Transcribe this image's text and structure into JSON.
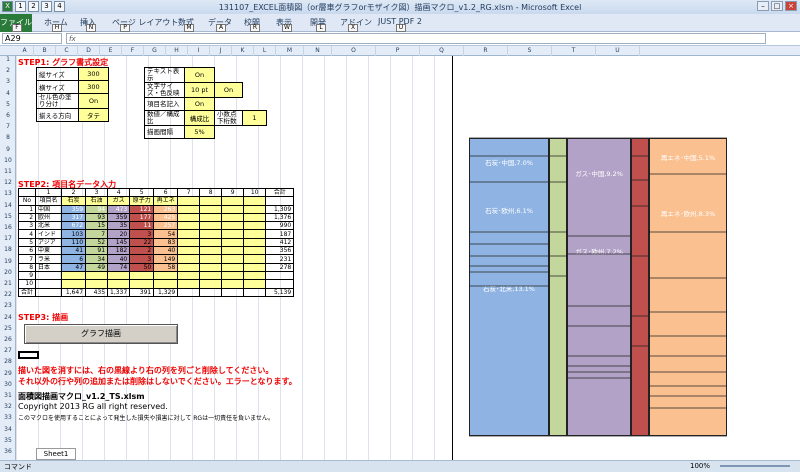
{
  "window": {
    "title": "131107_EXCEL面積図（or層車グラフorモザイク図）描画マクロ_v1.2_RG.xlsm - Microsoft Excel",
    "qat": [
      "1",
      "2",
      "3",
      "4"
    ],
    "controls": [
      "–",
      "□",
      "×"
    ]
  },
  "ribbon": {
    "tabs": [
      "ファイル",
      "ホーム",
      "挿入",
      "ページ レイアウト",
      "数式",
      "データ",
      "校閲",
      "表示",
      "開発",
      "アドイン",
      "JUST PDF 2"
    ],
    "keytips": [
      "F",
      "H",
      "N",
      "P",
      "M",
      "A",
      "R",
      "W",
      "L",
      "X",
      "U"
    ]
  },
  "formula_bar": {
    "name_box": "A29",
    "fx": "fx"
  },
  "columns": [
    "A",
    "B",
    "C",
    "D",
    "E",
    "F",
    "G",
    "H",
    "I",
    "J",
    "K",
    "L",
    "M",
    "N",
    "O",
    "P",
    "Q",
    "R",
    "S",
    "T",
    "U"
  ],
  "rows": [
    "1",
    "2",
    "3",
    "4",
    "5",
    "6",
    "7",
    "8",
    "9",
    "10",
    "11",
    "12",
    "13",
    "14",
    "15",
    "16",
    "17",
    "18",
    "19",
    "20",
    "21",
    "22",
    "23",
    "24",
    "25",
    "26",
    "27",
    "28",
    "29",
    "30",
    "31",
    "32",
    "33",
    "34",
    "35",
    "36"
  ],
  "step1": {
    "title": "STEP1: グラフ書式設定",
    "left": [
      {
        "k": "縦サイズ",
        "v": "300"
      },
      {
        "k": "横サイズ",
        "v": "300"
      },
      {
        "k": "セル色の塗り分け",
        "v": "On"
      },
      {
        "k": "揃える方向",
        "v": "タテ"
      }
    ],
    "right": [
      {
        "k": "テキスト表示",
        "v": "On",
        "v2": ""
      },
      {
        "k": "文字サイズ・色反映",
        "v": "10 pt",
        "v2": "On"
      },
      {
        "k": "項目名記入",
        "v": "On",
        "v2": ""
      },
      {
        "k": "数値／構成比",
        "v": "構成比",
        "k2": "小数点下桁数",
        "v2": "1"
      },
      {
        "k": "描画間隔",
        "v": "5%",
        "v2": ""
      }
    ]
  },
  "step2": {
    "title": "STEP2: 項目名データ入力",
    "header_nums": [
      "",
      "1",
      "2",
      "3",
      "4",
      "5",
      "6",
      "7",
      "8",
      "9",
      "10",
      "合計"
    ],
    "header_names": [
      "No",
      "項目名",
      "石炭",
      "石油",
      "ガス",
      "原子力",
      "再エネ",
      "",
      "",
      "",
      "",
      "",
      ""
    ],
    "rows": [
      [
        "1",
        "中国",
        "359",
        "94",
        "473",
        "121",
        "263",
        "",
        "",
        "",
        "",
        "",
        "1,309"
      ],
      [
        "2",
        "欧州",
        "317",
        "93",
        "359",
        "177",
        "425",
        "",
        "",
        "",
        "",
        "",
        "1,376"
      ],
      [
        "3",
        "北米",
        "672",
        "15",
        "35",
        "11",
        "257",
        "",
        "",
        "",
        "",
        "",
        "990"
      ],
      [
        "4",
        "インド",
        "103",
        "7",
        "20",
        "3",
        "54",
        "",
        "",
        "",
        "",
        "",
        "187"
      ],
      [
        "5",
        "アジア",
        "110",
        "52",
        "145",
        "22",
        "83",
        "",
        "",
        "",
        "",
        "",
        "412"
      ],
      [
        "6",
        "中東",
        "41",
        "91",
        "182",
        "2",
        "40",
        "",
        "",
        "",
        "",
        "",
        "356"
      ],
      [
        "7",
        "ラ米",
        "6",
        "34",
        "40",
        "3",
        "149",
        "",
        "",
        "",
        "",
        "",
        "231"
      ],
      [
        "8",
        "日本",
        "47",
        "49",
        "74",
        "50",
        "58",
        "",
        "",
        "",
        "",
        "",
        "278"
      ],
      [
        "9",
        "",
        "",
        "",
        "",
        "",
        "",
        "",
        "",
        "",
        "",
        "",
        "",
        ""
      ],
      [
        "10",
        "",
        "",
        "",
        "",
        "",
        "",
        "",
        "",
        "",
        "",
        "",
        "",
        ""
      ]
    ],
    "total": [
      "合計",
      "",
      "1,647",
      "435",
      "1,337",
      "391",
      "1,329",
      "",
      "",
      "",
      "",
      "",
      "5,139"
    ]
  },
  "step3": {
    "title": "STEP3: 描画",
    "button": "グラフ描画"
  },
  "notes": [
    "描いた図を消すには、右の黒線より右の列を列ごと削除してください。",
    "それ以外の行や列の追加または削除はしないでください。エラーとなります。"
  ],
  "footer": {
    "name": "面積図描画マクロ_v1.2_TS.xlsm",
    "copyright": "Copyright 2013 RG all right reserved.",
    "disclaimer": "このマクロを使用することによって発生した損失や損害に対して RGは一切責任を負いません。"
  },
  "chart": {
    "labels": {
      "coal_china": "石炭･中国,7.0%",
      "coal_eu": "石炭･欧州,6.1%",
      "coal_na": "石炭･北米,13.1%",
      "gas_china": "ガス･中国,9.2%",
      "gas_eu": "ガス･欧州,7.2%",
      "ren_china": "再エネ･中国,5.1%",
      "ren_eu": "再エネ･欧州,8.3%"
    },
    "colors": {
      "coal": "#8fb4e3",
      "oil": "#c3d69b",
      "gas": "#b3a2c7",
      "nuclear": "#c0504d",
      "renew": "#fac090"
    }
  },
  "status": {
    "mode": "コマンド",
    "sheet": "Sheet1",
    "zoom": "100%"
  }
}
